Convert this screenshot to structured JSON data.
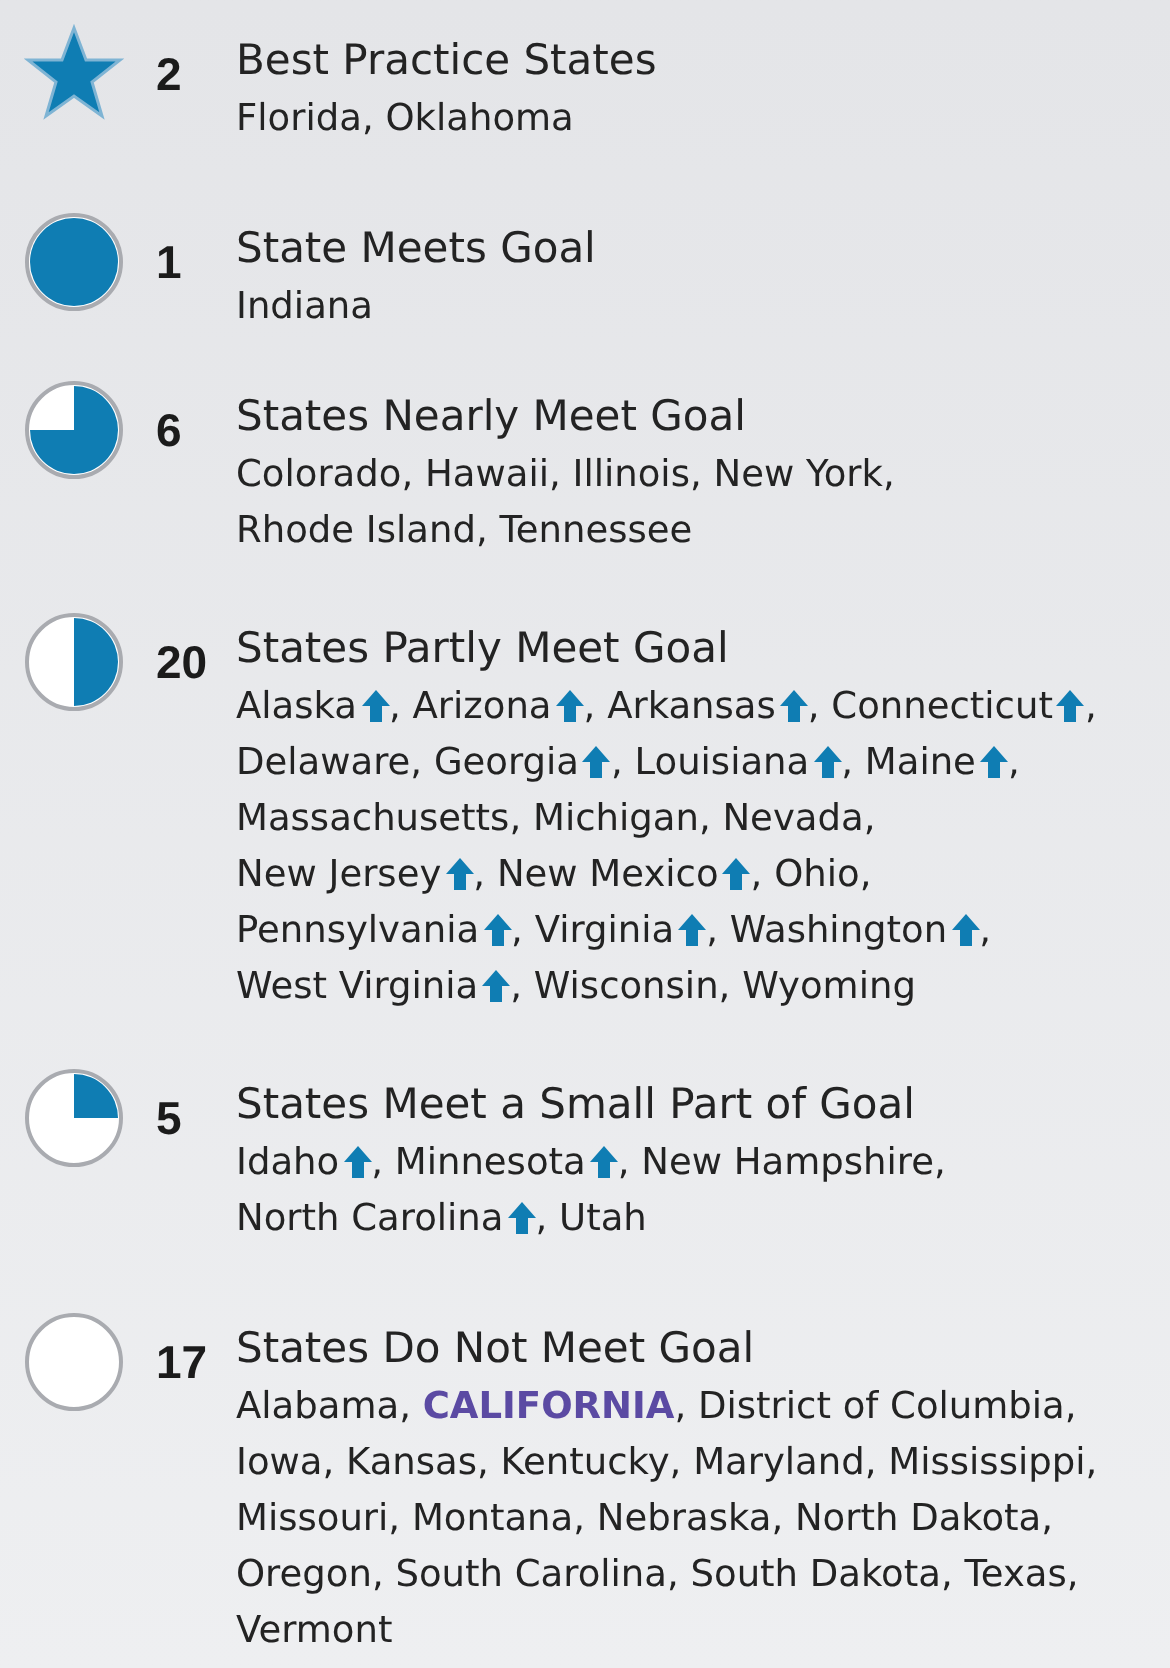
{
  "groups": [
    {
      "kind": "star",
      "count": "2",
      "title": "Best Practice States",
      "states": [
        {
          "name": "Florida",
          "up": false,
          "emphasis": false,
          "sep": ","
        },
        {
          "name": "Oklahoma",
          "up": false,
          "emphasis": false
        }
      ]
    },
    {
      "kind": "full",
      "count": "1",
      "title": "State Meets Goal",
      "states": [
        {
          "name": "Indiana",
          "up": false,
          "emphasis": false
        }
      ]
    },
    {
      "kind": "three_quarter",
      "count": "6",
      "title": "States Nearly Meet Goal",
      "states": [
        {
          "name": "Colorado",
          "up": false,
          "emphasis": false,
          "sep": ","
        },
        {
          "name": "Hawaii",
          "up": false,
          "emphasis": false,
          "sep": ","
        },
        {
          "name": "Illinois",
          "up": false,
          "emphasis": false,
          "sep": ","
        },
        {
          "name": "New York",
          "up": false,
          "emphasis": false,
          "sep": ","
        },
        {
          "name": "Rhode Island",
          "up": false,
          "emphasis": false,
          "sep": ","
        },
        {
          "name": "Tennessee",
          "up": false,
          "emphasis": false
        }
      ]
    },
    {
      "kind": "half",
      "count": "20",
      "title": "States Partly Meet Goal",
      "states": [
        {
          "name": "Alaska",
          "up": true,
          "emphasis": false,
          "sep": ","
        },
        {
          "name": "Arizona",
          "up": true,
          "emphasis": false,
          "sep": ","
        },
        {
          "name": "Arkansas",
          "up": true,
          "emphasis": false,
          "sep": ","
        },
        {
          "name": "Connecticut",
          "up": true,
          "emphasis": false,
          "sep": ","
        },
        {
          "name": "Delaware",
          "up": false,
          "emphasis": false,
          "sep": ","
        },
        {
          "name": "Georgia",
          "up": true,
          "emphasis": false,
          "sep": ","
        },
        {
          "name": "Louisiana",
          "up": true,
          "emphasis": false,
          "sep": ","
        },
        {
          "name": "Maine",
          "up": true,
          "emphasis": false,
          "sep": ","
        },
        {
          "name": "Massachusetts",
          "up": false,
          "emphasis": false,
          "sep": ","
        },
        {
          "name": "Michigan",
          "up": false,
          "emphasis": false,
          "sep": ","
        },
        {
          "name": "Nevada",
          "up": false,
          "emphasis": false,
          "sep": ","
        },
        {
          "name": "New Jersey",
          "up": true,
          "emphasis": false,
          "sep": ","
        },
        {
          "name": "New Mexico",
          "up": true,
          "emphasis": false,
          "sep": ","
        },
        {
          "name": "Ohio",
          "up": false,
          "emphasis": false,
          "sep": ","
        },
        {
          "name": "Pennsylvania",
          "up": true,
          "emphasis": false,
          "sep": ","
        },
        {
          "name": "Virginia",
          "up": true,
          "emphasis": false,
          "sep": ","
        },
        {
          "name": "Washington",
          "up": true,
          "emphasis": false,
          "sep": ","
        },
        {
          "name": "West Virginia",
          "up": true,
          "emphasis": false,
          "sep": ","
        },
        {
          "name": "Wisconsin",
          "up": false,
          "emphasis": false,
          "sep": ","
        },
        {
          "name": "Wyoming",
          "up": false,
          "emphasis": false
        }
      ]
    },
    {
      "kind": "quarter",
      "count": "5",
      "title": "States Meet a Small Part of Goal",
      "states": [
        {
          "name": "Idaho",
          "up": true,
          "emphasis": false,
          "sep": ","
        },
        {
          "name": "Minnesota",
          "up": true,
          "emphasis": false,
          "sep": ","
        },
        {
          "name": "New Hampshire",
          "up": false,
          "emphasis": false,
          "sep": ","
        },
        {
          "name": "North Carolina",
          "up": true,
          "emphasis": false,
          "sep": ","
        },
        {
          "name": "Utah",
          "up": false,
          "emphasis": false
        }
      ]
    },
    {
      "kind": "empty",
      "count": "17",
      "title": "States Do Not Meet Goal",
      "states": [
        {
          "name": "Alabama",
          "up": false,
          "emphasis": false,
          "sep": ","
        },
        {
          "name": "CALIFORNIA",
          "up": false,
          "emphasis": true,
          "sep": ","
        },
        {
          "name": "District of Columbia",
          "up": false,
          "emphasis": false,
          "sep": ","
        },
        {
          "name": "Iowa",
          "up": false,
          "emphasis": false,
          "sep": ","
        },
        {
          "name": "Kansas",
          "up": false,
          "emphasis": false,
          "sep": ","
        },
        {
          "name": "Kentucky",
          "up": false,
          "emphasis": false,
          "sep": ","
        },
        {
          "name": "Maryland",
          "up": false,
          "emphasis": false,
          "sep": ","
        },
        {
          "name": "Mississippi",
          "up": false,
          "emphasis": false,
          "sep": ","
        },
        {
          "name": "Missouri",
          "up": false,
          "emphasis": false,
          "sep": ","
        },
        {
          "name": "Montana",
          "up": false,
          "emphasis": false,
          "sep": ","
        },
        {
          "name": "Nebraska",
          "up": false,
          "emphasis": false,
          "sep": ","
        },
        {
          "name": "North Dakota",
          "up": false,
          "emphasis": false,
          "sep": ","
        },
        {
          "name": "Oregon",
          "up": false,
          "emphasis": false,
          "sep": ","
        },
        {
          "name": "South Carolina",
          "up": false,
          "emphasis": false,
          "sep": ","
        },
        {
          "name": "South Dakota",
          "up": false,
          "emphasis": false,
          "sep": ","
        },
        {
          "name": "Texas",
          "up": false,
          "emphasis": false,
          "sep": ","
        },
        {
          "name": "Vermont",
          "up": false,
          "emphasis": false
        }
      ]
    }
  ]
}
